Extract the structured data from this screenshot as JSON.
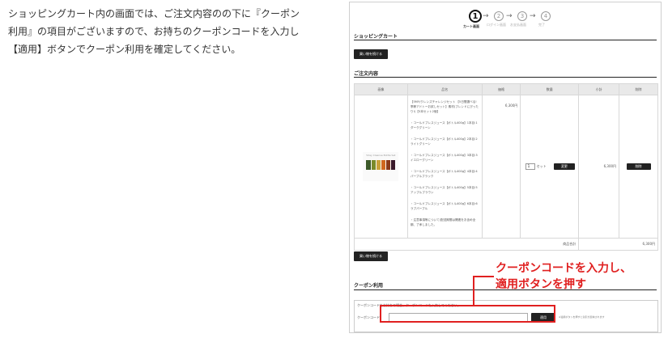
{
  "intro": {
    "line1": "ショッピングカート内の画面では、ご注文内容のの下に『クーポン",
    "line2": "利用』の項目がございますので、お持ちのクーポンコードを入力し",
    "line3": "【適用】ボタンでクーポン利用を確定してください。"
  },
  "steps": [
    {
      "num": "1",
      "label": "カート画面"
    },
    {
      "num": "2",
      "label": "ログイン画面"
    },
    {
      "num": "3",
      "label": "お支払画面"
    },
    {
      "num": "4",
      "label": "完了"
    }
  ],
  "cart_title": "ショッピングカート",
  "continue_label": "買い物を続ける",
  "order_title": "ご注文内容",
  "columns": [
    "画像",
    "品名",
    "価格",
    "数量",
    "小計",
    "削除"
  ],
  "item": {
    "image_caption": "5day Cleanse Bottle Set",
    "desc": [
      "【5MY/クレンズチャレンジセット 【5日間選べる!季節アドトーお試しセット】素材(ブレンドにぴったり!)【5本セット2個】",
      "・コールドプレスジュース【ボトル400g】1本目:1ダークグリーン",
      "・コールドプレスジュース【ボトル400g】2本目:2ライトグリーン",
      "・コールドプレスジュース【ボトル400g】3本目:3イエローグリーン",
      "・コールドプレスジュース【ボトル400g】4本目:4パープルブラック",
      "・コールドプレスジュース【ボトル400g】5本目:5アップルブラウン",
      "・コールドプレスジュース【ボトル400g】6本目:6ラブパープル",
      "・注意事項等について(配送期間は関連をお含め全期、了承しました。"
    ],
    "price": "6,300円",
    "qty": "1",
    "unit": "セット",
    "change_label": "変更",
    "subtotal": "6,300円",
    "delete_label": "削除"
  },
  "total_label": "商品合計",
  "total_value": "6,300円",
  "coupon": {
    "title": "クーポン利用",
    "note": "クーポンコードをお持ちの場合、クーポンコードを入力してください。",
    "field_label": "クーポンコード",
    "input_value": "",
    "apply_label": "適用",
    "hint": "※適用ボタンを押すと割引が反映されます"
  },
  "callout": {
    "line1": "クーポンコードを入力し、",
    "line2": "適用ボタンを押す"
  },
  "colors": {
    "accent_red": "#e02020",
    "button_black": "#222222"
  }
}
